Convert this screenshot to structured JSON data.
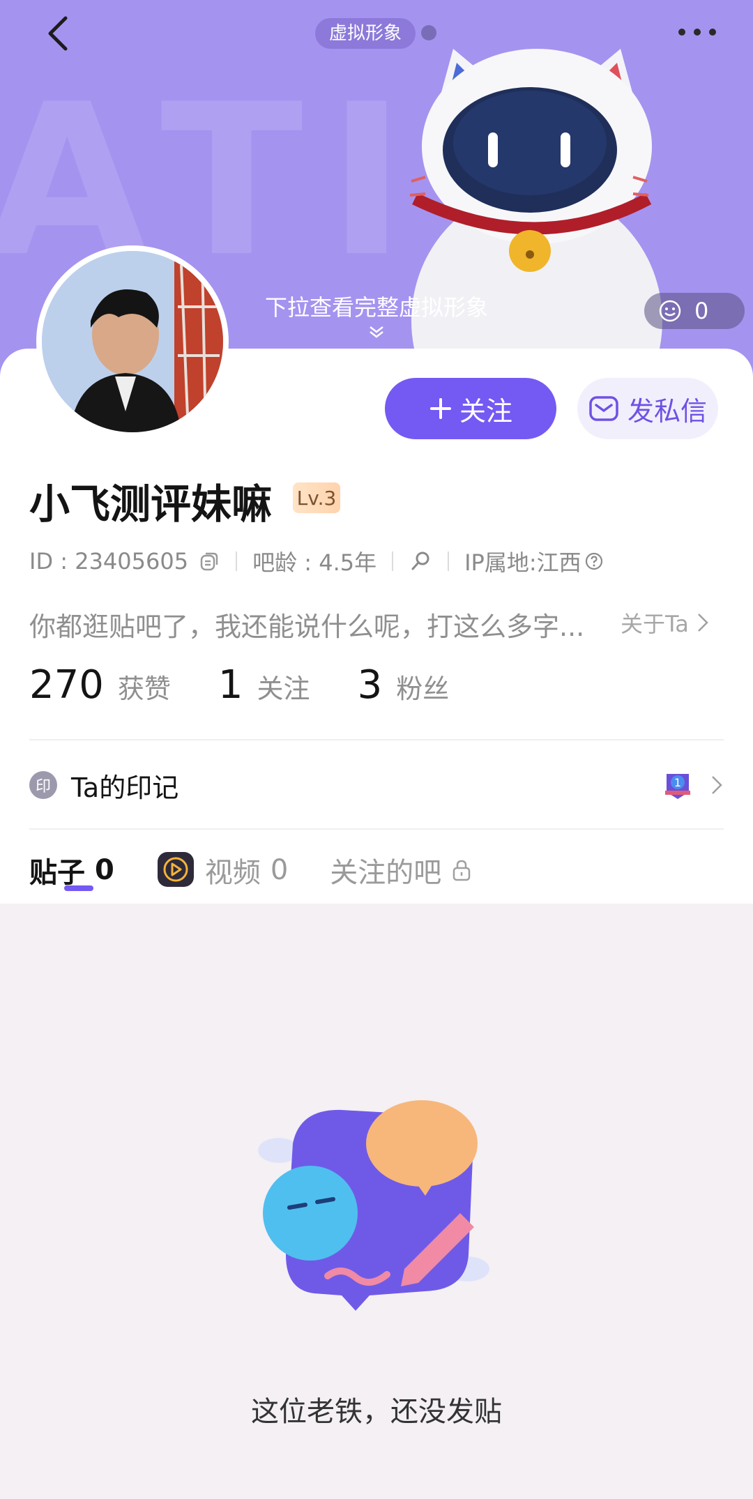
{
  "colors": {
    "banner": "#a593f0",
    "accent": "#7559f3",
    "accent_light": "#f2effd",
    "page_bg": "#f4f0f4"
  },
  "header": {
    "back_icon": "chevron-left-icon",
    "avatar_pill_label": "虚拟形象",
    "more_icon": "more-dots-icon",
    "pull_hint": "下拉查看完整虚拟形象",
    "like_count": "0"
  },
  "profile": {
    "follow_label": "关注",
    "dm_label": "发私信",
    "username": "小飞测评妹嘛",
    "level": "Lv.3",
    "id_text": "ID : 23405605",
    "age_text": "吧龄 : 4.5年",
    "ip_text": "IP属地:江西",
    "bio": "你都逛贴吧了，我还能说什么呢，打这么多字...",
    "about_label": "关于Ta",
    "stats": [
      {
        "num": "270",
        "label": "获赞"
      },
      {
        "num": "1",
        "label": "关注"
      },
      {
        "num": "3",
        "label": "粉丝"
      }
    ],
    "seal_icon_char": "印",
    "seal_label": "Ta的印记",
    "seal_badge_number": "1"
  },
  "tabs": [
    {
      "label": "贴子",
      "count": "0"
    },
    {
      "label": "视频",
      "count": "0"
    },
    {
      "label": "关注的吧"
    }
  ],
  "empty_state": {
    "message": "这位老铁，还没发贴"
  }
}
